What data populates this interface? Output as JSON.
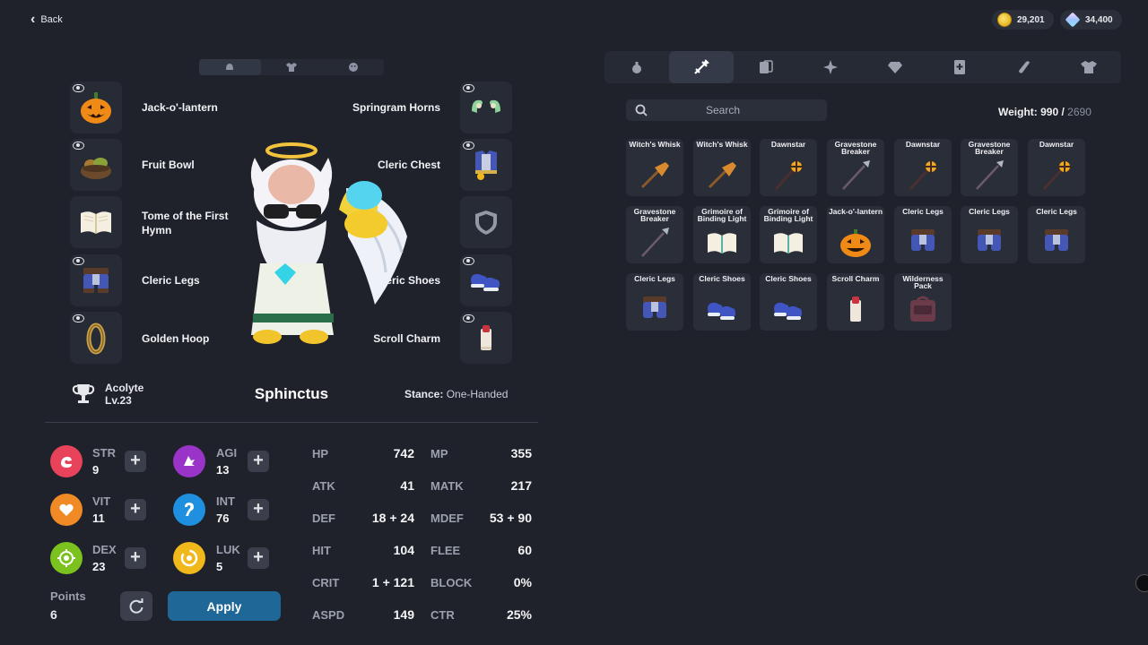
{
  "header": {
    "back_label": "Back",
    "gold": "29,201",
    "gems": "34,400"
  },
  "equipment": {
    "left": [
      {
        "label": "Jack-o'-lantern",
        "icon": "pumpkin-icon",
        "visible": true
      },
      {
        "label": "Fruit Bowl",
        "icon": "fruit-bowl-icon",
        "visible": true
      },
      {
        "label": "Tome of the First Hymn",
        "icon": "tome-icon",
        "visible": false
      },
      {
        "label": "Cleric Legs",
        "icon": "cleric-legs-icon",
        "visible": true
      },
      {
        "label": "Golden Hoop",
        "icon": "golden-hoop-icon",
        "visible": true
      }
    ],
    "right": [
      {
        "label": "Springram Horns",
        "icon": "horns-icon",
        "visible": true
      },
      {
        "label": "Cleric Chest",
        "icon": "cleric-chest-icon",
        "visible": true
      },
      {
        "label": "",
        "icon": "shield-slot-icon",
        "visible": false
      },
      {
        "label": "Cleric Shoes",
        "icon": "cleric-shoes-icon",
        "visible": true
      },
      {
        "label": "Scroll Charm",
        "icon": "scroll-charm-icon",
        "visible": true
      }
    ]
  },
  "character": {
    "class_name": "Acolyte",
    "level": "Lv.23",
    "name": "Sphinctus",
    "stance_label": "Stance:",
    "stance_value": "One-Handed"
  },
  "base_stats": [
    {
      "name": "STR",
      "value": "9",
      "color": "#e8435a"
    },
    {
      "name": "AGI",
      "value": "13",
      "color": "#9a34c9"
    },
    {
      "name": "VIT",
      "value": "11",
      "color": "#f08a24"
    },
    {
      "name": "INT",
      "value": "76",
      "color": "#1f8fe0"
    },
    {
      "name": "DEX",
      "value": "23",
      "color": "#7cc21f"
    },
    {
      "name": "LUK",
      "value": "5",
      "color": "#f0b81a"
    }
  ],
  "points": {
    "label": "Points",
    "value": "6"
  },
  "apply_label": "Apply",
  "sub_stats": [
    {
      "name": "HP",
      "value": "742"
    },
    {
      "name": "MP",
      "value": "355"
    },
    {
      "name": "ATK",
      "value": "41"
    },
    {
      "name": "MATK",
      "value": "217"
    },
    {
      "name": "DEF",
      "value": "18 + 24"
    },
    {
      "name": "MDEF",
      "value": "53 + 90"
    },
    {
      "name": "HIT",
      "value": "104"
    },
    {
      "name": "FLEE",
      "value": "60"
    },
    {
      "name": "CRIT",
      "value": "1 + 121"
    },
    {
      "name": "BLOCK",
      "value": "0%"
    },
    {
      "name": "ASPD",
      "value": "149"
    },
    {
      "name": "CTR",
      "value": "25%"
    }
  ],
  "inventory": {
    "search_placeholder": "Search",
    "weight_label": "Weight:",
    "weight_current": "990",
    "weight_max": "2690",
    "items": [
      {
        "name": "Witch's Whisk",
        "icon": "broom-icon"
      },
      {
        "name": "Witch's Whisk",
        "icon": "broom-icon"
      },
      {
        "name": "Dawnstar",
        "icon": "morningstar-icon"
      },
      {
        "name": "Gravestone Breaker",
        "icon": "spear-icon"
      },
      {
        "name": "Dawnstar",
        "icon": "morningstar-icon"
      },
      {
        "name": "Gravestone Breaker",
        "icon": "spear-icon"
      },
      {
        "name": "Dawnstar",
        "icon": "morningstar-icon"
      },
      {
        "name": "Gravestone Breaker",
        "icon": "spear-icon"
      },
      {
        "name": "Grimoire of Binding Light",
        "icon": "tome-icon"
      },
      {
        "name": "Grimoire of Binding Light",
        "icon": "tome-icon"
      },
      {
        "name": "Jack-o'-lantern",
        "icon": "pumpkin-icon"
      },
      {
        "name": "Cleric Legs",
        "icon": "cleric-legs-icon"
      },
      {
        "name": "Cleric Legs",
        "icon": "cleric-legs-icon"
      },
      {
        "name": "Cleric Legs",
        "icon": "cleric-legs-icon"
      },
      {
        "name": "Cleric Legs",
        "icon": "cleric-legs-icon"
      },
      {
        "name": "Cleric Shoes",
        "icon": "cleric-shoes-icon"
      },
      {
        "name": "Cleric Shoes",
        "icon": "cleric-shoes-icon"
      },
      {
        "name": "Scroll Charm",
        "icon": "scroll-charm-icon"
      },
      {
        "name": "Wilderness Pack",
        "icon": "backpack-icon"
      }
    ]
  },
  "categories": [
    {
      "icon": "potion-icon",
      "active": false
    },
    {
      "icon": "weapon-icon",
      "active": true
    },
    {
      "icon": "card-icon",
      "active": false
    },
    {
      "icon": "material-icon",
      "active": false
    },
    {
      "icon": "gem-icon",
      "active": false
    },
    {
      "icon": "book-icon",
      "active": false
    },
    {
      "icon": "scroll-icon",
      "active": false
    },
    {
      "icon": "costume-icon",
      "active": false
    }
  ]
}
